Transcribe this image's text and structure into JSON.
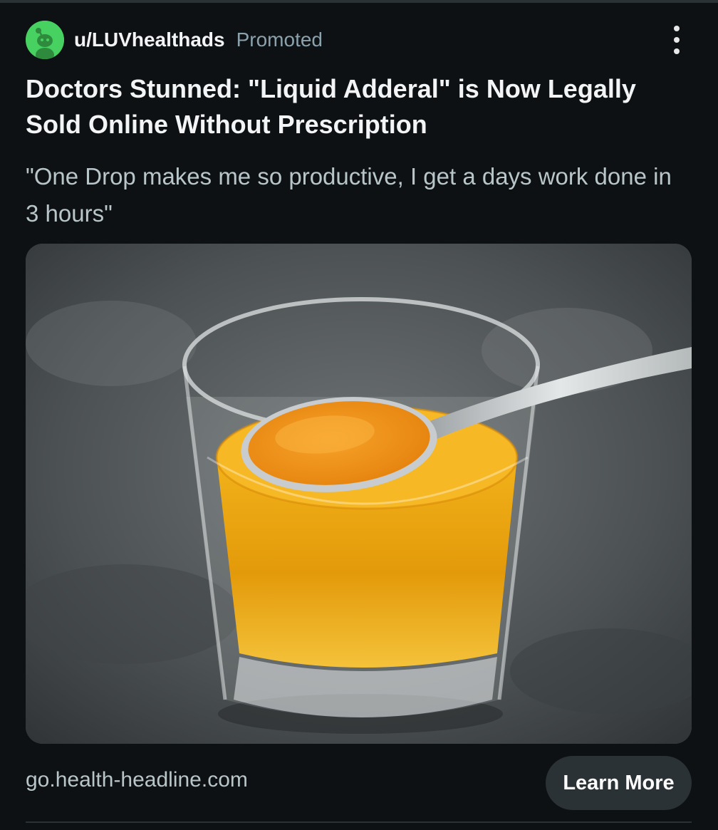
{
  "post": {
    "username": "u/LUVhealthads",
    "promoted_label": "Promoted",
    "title": "Doctors Stunned: \"Liquid Adderal\" is Now Legally Sold Online Without Prescription",
    "body": "\"One Drop makes me so productive, I get a days work done in 3 hours\"",
    "domain": "go.health-headline.com",
    "cta_label": "Learn More"
  },
  "icons": {
    "avatar": "snoo-avatar-icon",
    "more": "more-options-icon"
  },
  "colors": {
    "background": "#0e1113",
    "avatar": "#46d160",
    "button_bg": "#2a3236",
    "secondary_text": "#8ba2ad"
  }
}
